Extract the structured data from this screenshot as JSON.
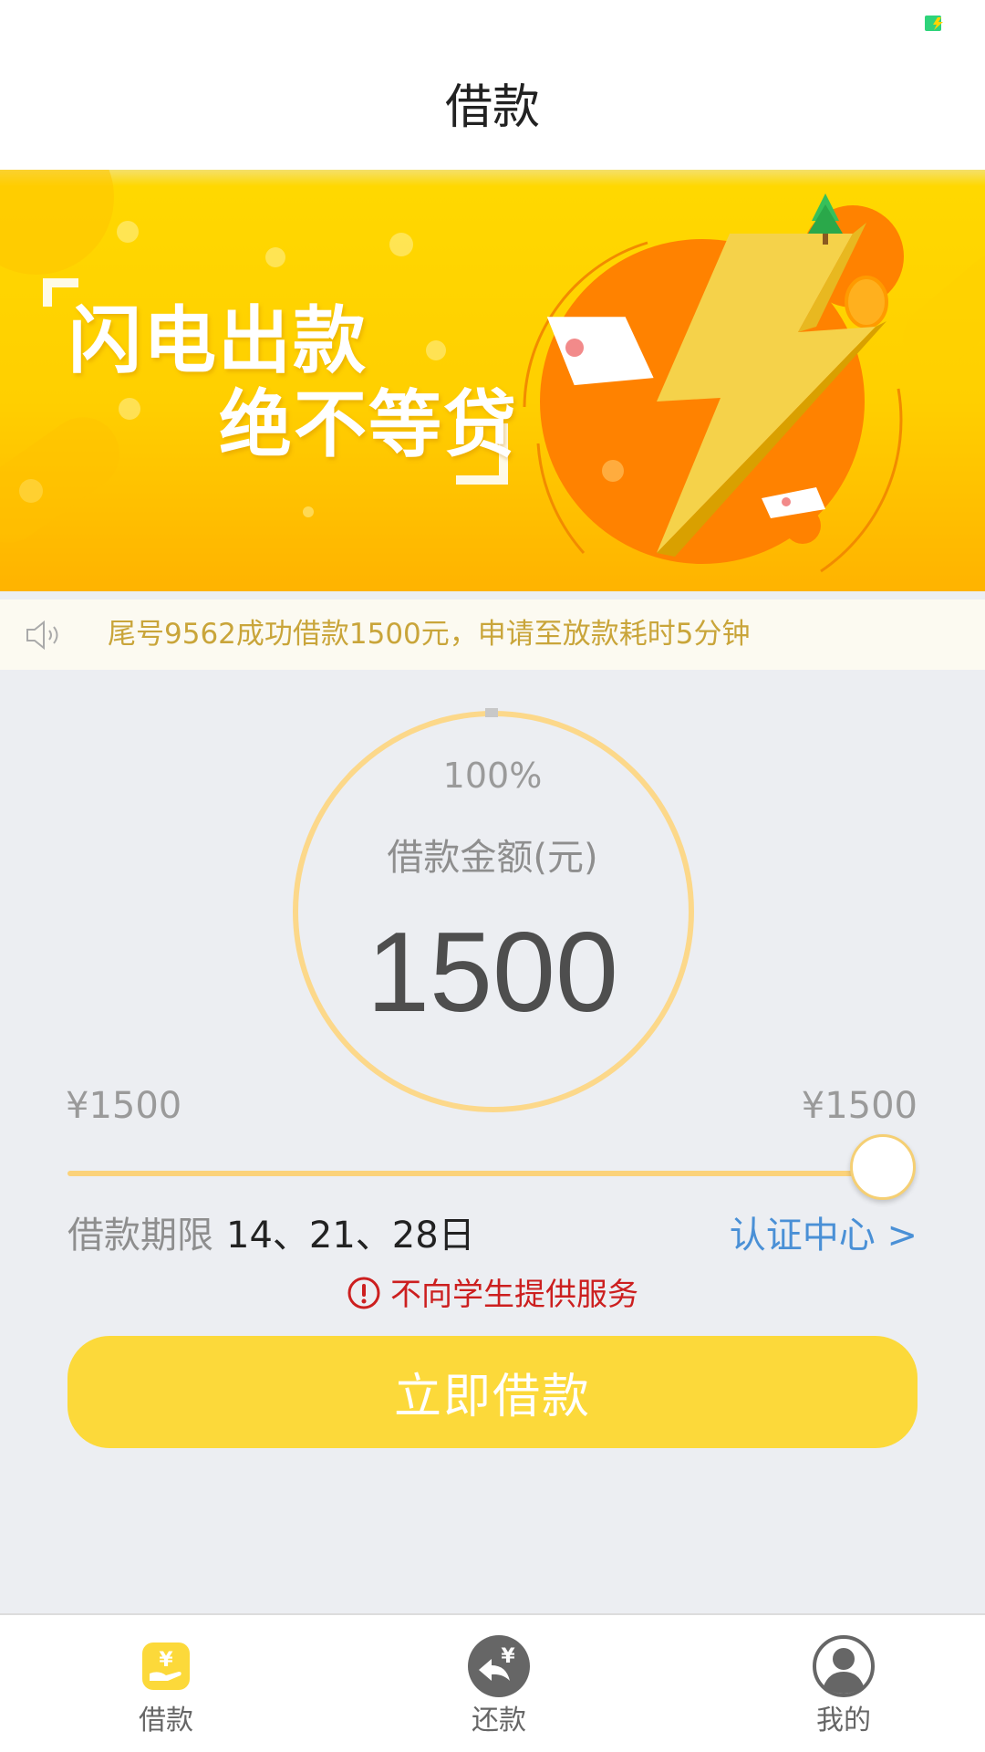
{
  "nav": {
    "title": "借款"
  },
  "banner": {
    "line1": "闪电出款",
    "line2": "绝不等贷"
  },
  "notice": {
    "text": "尾号9562成功借款1500元，申请至放款耗时5分钟"
  },
  "gauge": {
    "percent_label": "100%",
    "percent": 100,
    "label": "借款金额(元)",
    "amount": "1500"
  },
  "slider": {
    "min_label": "¥1500",
    "max_label": "¥1500",
    "value_fraction": 1.0
  },
  "term": {
    "label": "借款期限",
    "value": "14、21、28日"
  },
  "cert_link": "认证中心 >",
  "warning": "不向学生提供服务",
  "borrow_button": "立即借款",
  "tabs": [
    {
      "label": "借款",
      "icon": "yen-hand-icon",
      "active": true
    },
    {
      "label": "还款",
      "icon": "repay-arrow-icon",
      "active": false
    },
    {
      "label": "我的",
      "icon": "user-icon",
      "active": false
    }
  ],
  "colors": {
    "accent": "#fcd93a",
    "link": "#4a90d6",
    "warning": "#cc1f1f",
    "notice_text": "#c9a53a",
    "battery": "#2ed37a"
  }
}
